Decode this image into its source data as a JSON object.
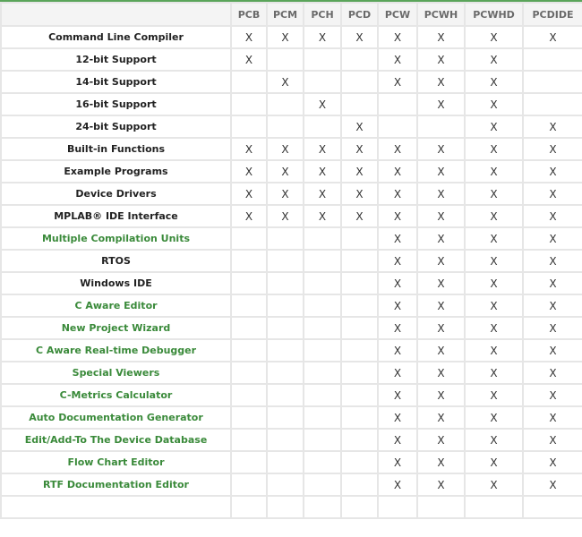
{
  "table": {
    "columns": [
      "",
      "PCB",
      "PCM",
      "PCH",
      "PCD",
      "PCW",
      "PCWH",
      "PCWHD",
      "PCDIDE"
    ],
    "mark_symbol": "X",
    "colors": {
      "link_green": "#3a8a3a",
      "header_border_green": "#5aa55a"
    },
    "rows": [
      {
        "feature": "Command Line Compiler",
        "highlight": false,
        "marks": [
          1,
          1,
          1,
          1,
          1,
          1,
          1,
          1
        ]
      },
      {
        "feature": "12-bit Support",
        "highlight": false,
        "marks": [
          1,
          0,
          0,
          0,
          1,
          1,
          1,
          0
        ]
      },
      {
        "feature": "14-bit Support",
        "highlight": false,
        "marks": [
          0,
          1,
          0,
          0,
          1,
          1,
          1,
          0
        ]
      },
      {
        "feature": "16-bit Support",
        "highlight": false,
        "marks": [
          0,
          0,
          1,
          0,
          0,
          1,
          1,
          0
        ]
      },
      {
        "feature": "24-bit Support",
        "highlight": false,
        "marks": [
          0,
          0,
          0,
          1,
          0,
          0,
          1,
          1
        ]
      },
      {
        "feature": "Built-in Functions",
        "highlight": false,
        "marks": [
          1,
          1,
          1,
          1,
          1,
          1,
          1,
          1
        ]
      },
      {
        "feature": "Example Programs",
        "highlight": false,
        "marks": [
          1,
          1,
          1,
          1,
          1,
          1,
          1,
          1
        ]
      },
      {
        "feature": "Device Drivers",
        "highlight": false,
        "marks": [
          1,
          1,
          1,
          1,
          1,
          1,
          1,
          1
        ]
      },
      {
        "feature": "MPLAB® IDE Interface",
        "highlight": false,
        "marks": [
          1,
          1,
          1,
          1,
          1,
          1,
          1,
          1
        ]
      },
      {
        "feature": "Multiple Compilation Units",
        "highlight": true,
        "marks": [
          0,
          0,
          0,
          0,
          1,
          1,
          1,
          1
        ]
      },
      {
        "feature": "RTOS",
        "highlight": false,
        "marks": [
          0,
          0,
          0,
          0,
          1,
          1,
          1,
          1
        ]
      },
      {
        "feature": "Windows IDE",
        "highlight": false,
        "marks": [
          0,
          0,
          0,
          0,
          1,
          1,
          1,
          1
        ]
      },
      {
        "feature": "C Aware Editor",
        "highlight": true,
        "marks": [
          0,
          0,
          0,
          0,
          1,
          1,
          1,
          1
        ]
      },
      {
        "feature": "New Project Wizard",
        "highlight": true,
        "marks": [
          0,
          0,
          0,
          0,
          1,
          1,
          1,
          1
        ]
      },
      {
        "feature": "C Aware Real-time Debugger",
        "highlight": true,
        "marks": [
          0,
          0,
          0,
          0,
          1,
          1,
          1,
          1
        ]
      },
      {
        "feature": "Special Viewers",
        "highlight": true,
        "marks": [
          0,
          0,
          0,
          0,
          1,
          1,
          1,
          1
        ]
      },
      {
        "feature": "C-Metrics Calculator",
        "highlight": true,
        "marks": [
          0,
          0,
          0,
          0,
          1,
          1,
          1,
          1
        ]
      },
      {
        "feature": "Auto Documentation Generator",
        "highlight": true,
        "marks": [
          0,
          0,
          0,
          0,
          1,
          1,
          1,
          1
        ]
      },
      {
        "feature": "Edit/Add-To The Device Database",
        "highlight": true,
        "marks": [
          0,
          0,
          0,
          0,
          1,
          1,
          1,
          1
        ]
      },
      {
        "feature": "Flow Chart Editor",
        "highlight": true,
        "marks": [
          0,
          0,
          0,
          0,
          1,
          1,
          1,
          1
        ]
      },
      {
        "feature": "RTF Documentation Editor",
        "highlight": true,
        "marks": [
          0,
          0,
          0,
          0,
          1,
          1,
          1,
          1
        ]
      },
      {
        "feature": "",
        "highlight": false,
        "marks": [
          0,
          0,
          0,
          0,
          0,
          0,
          0,
          0
        ]
      }
    ]
  }
}
